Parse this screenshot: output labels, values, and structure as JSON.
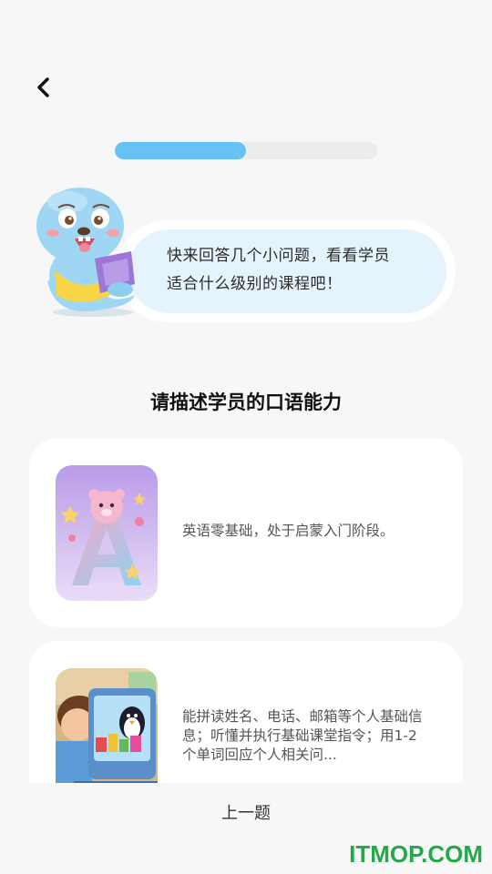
{
  "header": {
    "back_icon": "chevron-left-icon"
  },
  "progress": {
    "value": 0.5
  },
  "intro": {
    "mascot": "seal-mascot-with-book",
    "line1": "快来回答几个小问题，看看学员",
    "line2": "适合什么级别的课程吧！"
  },
  "question": {
    "title": "请描述学员的口语能力"
  },
  "options": [
    {
      "image": "bear-letter-a-illustration",
      "text": "英语零基础，处于启蒙入门阶段。"
    },
    {
      "image": "boy-with-tablet-illustration",
      "text": "能拼读姓名、电话、邮箱等个人基础信息；听懂并执行基础课堂指令；用1-2个单词回应个人相关问..."
    }
  ],
  "footer": {
    "prev_label": "上一题"
  },
  "watermark": "ITMOP.COM",
  "colors": {
    "accent": "#66c2f4",
    "bubble": "#e5f3fc",
    "watermark": "#23a84a"
  }
}
